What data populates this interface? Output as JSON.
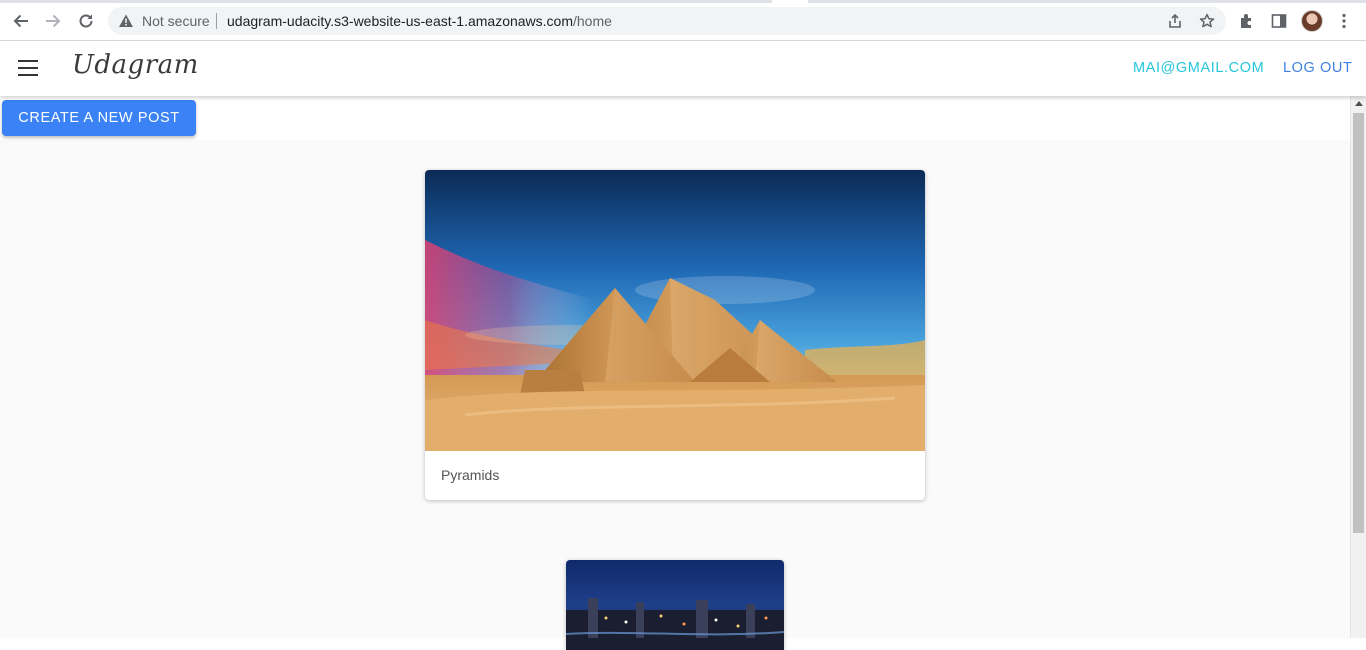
{
  "browser": {
    "security_label": "Not secure",
    "url_host": "udagram-udacity.s3-website-us-east-1.amazonaws.com",
    "url_path": "/home"
  },
  "app": {
    "brand": "Udagram",
    "nav": {
      "email": "MAI@GMAIL.COM",
      "logout": "LOG OUT"
    },
    "create_button": "CREATE A NEW POST"
  },
  "posts": [
    {
      "caption": "Pyramids"
    }
  ],
  "colors": {
    "accent_email": "#26c6da",
    "accent_logout": "#3f7fe0",
    "primary_button": "#3b82f6"
  }
}
